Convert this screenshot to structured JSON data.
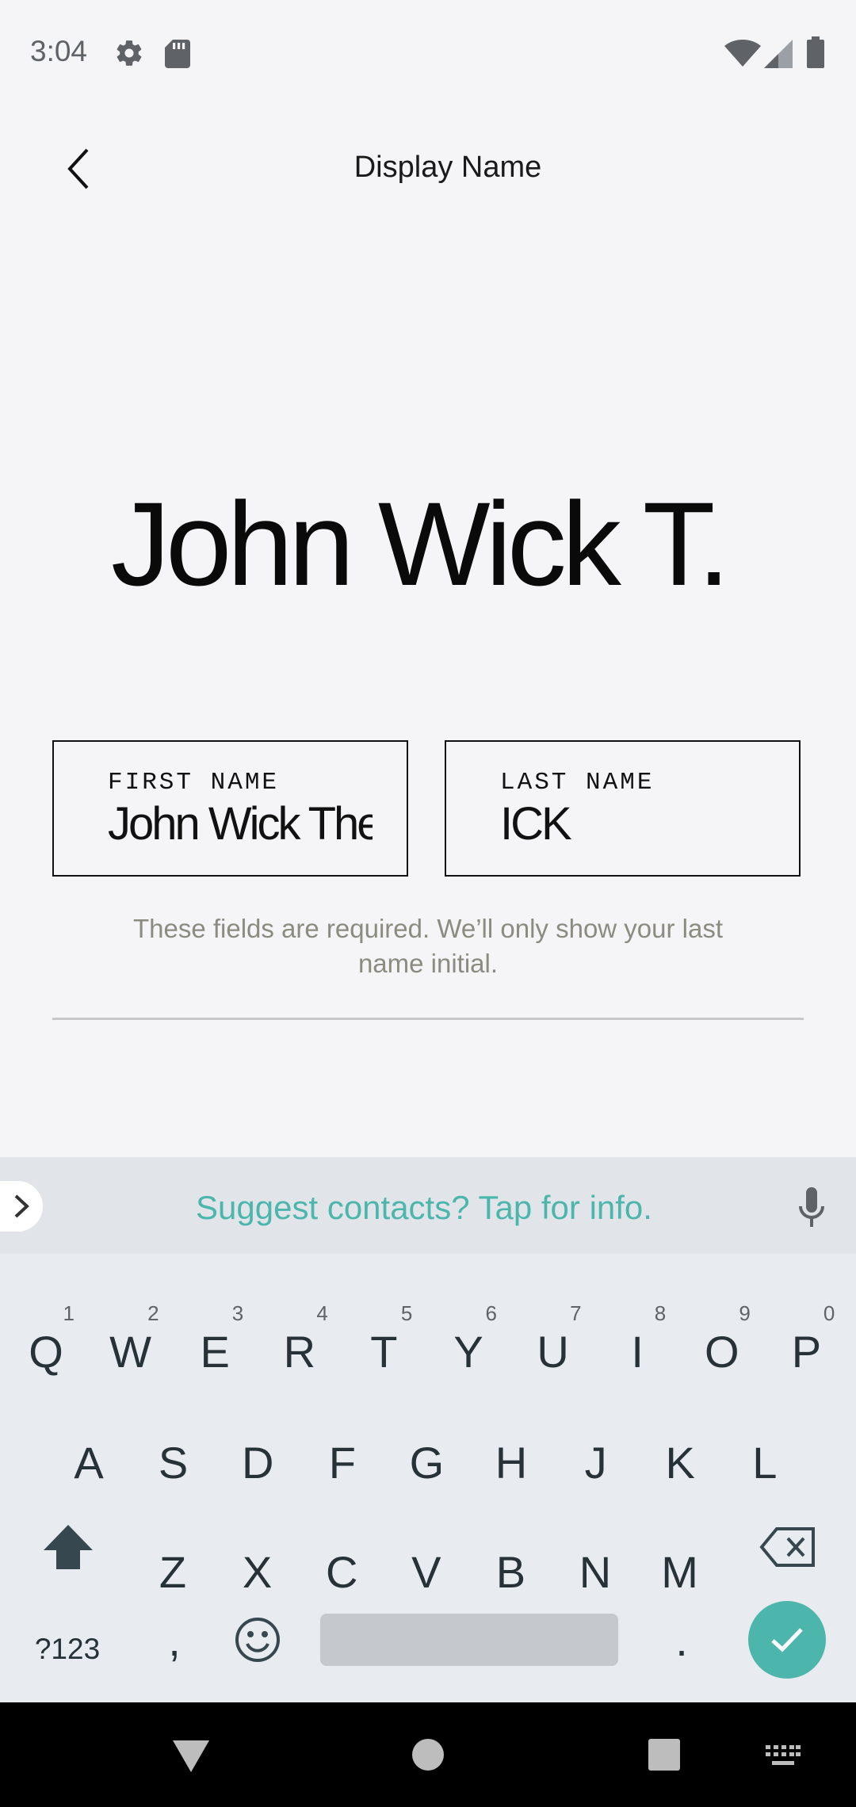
{
  "status_bar": {
    "time": "3:04",
    "icons": [
      "settings-icon",
      "sd-card-icon",
      "wifi-icon",
      "signal-icon",
      "battery-icon"
    ]
  },
  "header": {
    "title": "Display Name",
    "back_icon": "chevron-left-icon"
  },
  "preview": {
    "display_name": "John Wick T."
  },
  "form": {
    "first_name": {
      "label": "FIRST NAME",
      "value": "John Wick The"
    },
    "last_name": {
      "label": "LAST NAME",
      "value": "ICK"
    },
    "helper_text": "These fields are required. We’ll only show your last name initial."
  },
  "keyboard": {
    "suggestion": "Suggest contacts? Tap for info.",
    "row1": [
      {
        "k": "Q",
        "h": "1"
      },
      {
        "k": "W",
        "h": "2"
      },
      {
        "k": "E",
        "h": "3"
      },
      {
        "k": "R",
        "h": "4"
      },
      {
        "k": "T",
        "h": "5"
      },
      {
        "k": "Y",
        "h": "6"
      },
      {
        "k": "U",
        "h": "7"
      },
      {
        "k": "I",
        "h": "8"
      },
      {
        "k": "O",
        "h": "9"
      },
      {
        "k": "P",
        "h": "0"
      }
    ],
    "row2": [
      "A",
      "S",
      "D",
      "F",
      "G",
      "H",
      "J",
      "K",
      "L"
    ],
    "row3": [
      "Z",
      "X",
      "C",
      "V",
      "B",
      "N",
      "M"
    ],
    "symbols_label": "?123",
    "comma": ",",
    "period": ".",
    "accent_color": "#4db6ac"
  },
  "nav_bar": {
    "icons": [
      "back-triangle-icon",
      "home-circle-icon",
      "recents-square-icon",
      "keyboard-switch-icon"
    ]
  }
}
